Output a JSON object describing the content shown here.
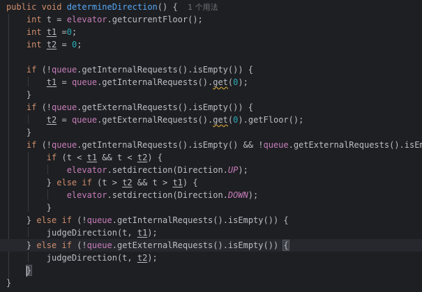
{
  "editor": {
    "usage_hint": "1 个用法",
    "lines": [
      [
        "public",
        " ",
        "void",
        " ",
        "determineDirection",
        "() {  "
      ],
      [
        "    ",
        "int",
        " t = ",
        "elevator",
        ".getcurrentFloor();"
      ],
      [
        "    ",
        "int",
        " ",
        "t1",
        " =",
        "0",
        ";"
      ],
      [
        "    ",
        "int",
        " ",
        "t2",
        " = ",
        "0",
        ";"
      ],
      [
        ""
      ],
      [
        "    ",
        "if",
        " (!",
        "queue",
        ".getInternalRequests().isEmpty()) {"
      ],
      [
        "        ",
        "t1",
        " = ",
        "queue",
        ".getInternalRequests().",
        "get",
        "(",
        "0",
        ");"
      ],
      [
        "    }"
      ],
      [
        "    ",
        "if",
        " (!",
        "queue",
        ".getExternalRequests().isEmpty()) {"
      ],
      [
        "        ",
        "t2",
        " = ",
        "queue",
        ".getExternalRequests().",
        "get",
        "(",
        "0",
        ").getFloor();"
      ],
      [
        "    }"
      ],
      [
        "    ",
        "if",
        " (!",
        "queue",
        ".getInternalRequests().isEmpty() && !",
        "queue",
        ".getExternalRequests().isEmpty()) {"
      ],
      [
        "        ",
        "if",
        " (t < ",
        "t1",
        " && t < ",
        "t2",
        ") {"
      ],
      [
        "            ",
        "elevator",
        ".setdirection(Direction.",
        "UP",
        ");"
      ],
      [
        "        } ",
        "else if",
        " (t > ",
        "t2",
        " && t > ",
        "t1",
        ") {"
      ],
      [
        "            ",
        "elevator",
        ".setdirection(Direction.",
        "DOWN",
        ");"
      ],
      [
        "        }"
      ],
      [
        "    } ",
        "else if",
        " (!",
        "queue",
        ".getInternalRequests().isEmpty()) {"
      ],
      [
        "        judgeDirection(t, ",
        "t1",
        ");"
      ],
      [
        "    } ",
        "else if",
        " (!",
        "queue",
        ".getExternalRequests().isEmpty()) ",
        "{"
      ],
      [
        "        judgeDirection(t, ",
        "t2",
        ");"
      ],
      [
        "    ",
        "}"
      ],
      [
        "}"
      ]
    ]
  }
}
